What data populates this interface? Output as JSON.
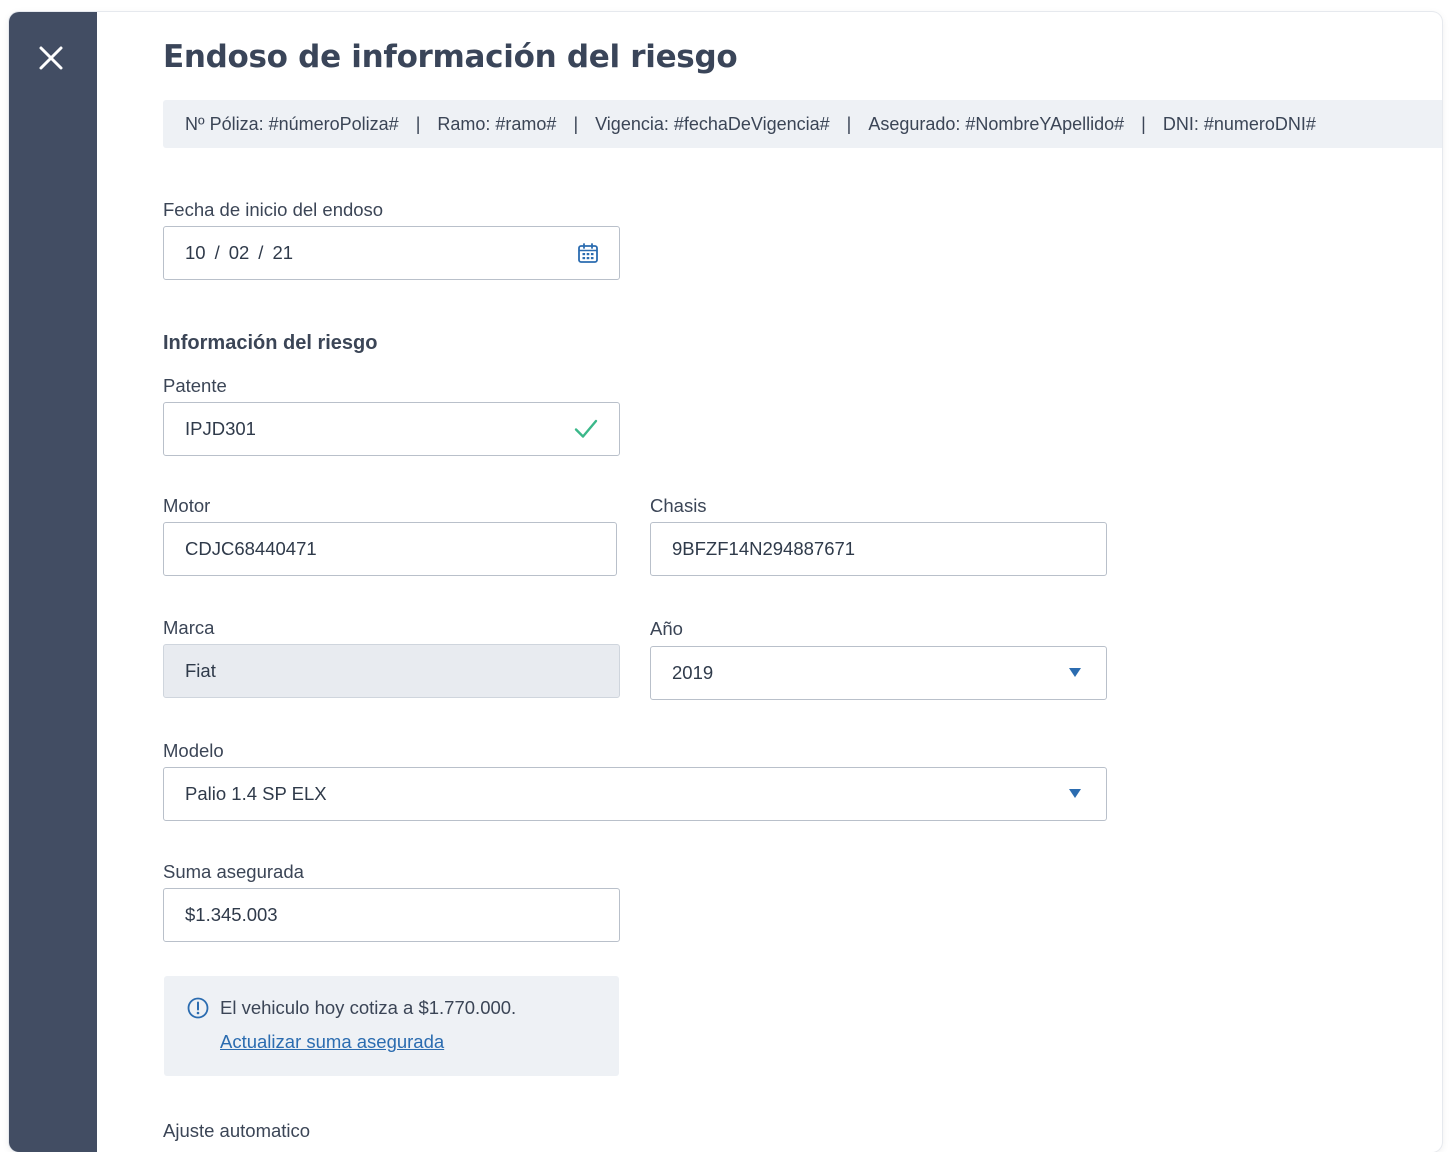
{
  "modal": {
    "title": "Endoso de información del riesgo"
  },
  "policy_info": {
    "poliza": "Nº Póliza: #númeroPoliza#",
    "ramo": "Ramo: #ramo#",
    "vigencia": "Vigencia: #fechaDeVigencia#",
    "asegurado": "Asegurado: #NombreYApellido#",
    "dni": "DNI: #numeroDNI#",
    "separator": "|"
  },
  "fecha_inicio": {
    "label": "Fecha de inicio del endoso",
    "day": "10",
    "month": "02",
    "year": "21",
    "separator": "/"
  },
  "riesgo": {
    "section_title": "Información del riesgo",
    "patente": {
      "label": "Patente",
      "value": "IPJD301"
    },
    "motor": {
      "label": "Motor",
      "value": "CDJC68440471"
    },
    "chasis": {
      "label": "Chasis",
      "value": "9BFZF14N294887671"
    },
    "marca": {
      "label": "Marca",
      "value": "Fiat"
    },
    "anio": {
      "label": "Año",
      "value": "2019"
    },
    "modelo": {
      "label": "Modelo",
      "value": "Palio 1.4 SP ELX"
    },
    "suma": {
      "label": "Suma asegurada",
      "value": "$1.345.003"
    }
  },
  "notice": {
    "text": "El vehiculo hoy cotiza a $1.770.000.",
    "link": "Actualizar suma asegurada"
  },
  "ajuste": {
    "label": "Ajuste automatico"
  },
  "colors": {
    "sidebar": "#424d63",
    "success": "#3bb88a",
    "accent": "#2b6cb0"
  }
}
